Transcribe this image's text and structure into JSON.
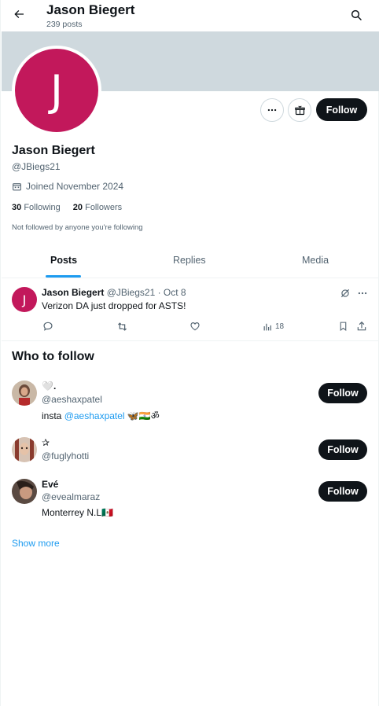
{
  "header": {
    "title": "Jason Biegert",
    "post_count": "239 posts"
  },
  "profile": {
    "avatar_letter": "J",
    "name": "Jason Biegert",
    "handle": "@JBiegs21",
    "joined": "Joined November 2024",
    "following_count": "30",
    "following_label": "Following",
    "followers_count": "20",
    "followers_label": "Followers",
    "not_followed_note": "Not followed by anyone you're following",
    "follow_label": "Follow",
    "accent_color": "#c2185b"
  },
  "tabs": [
    {
      "label": "Posts",
      "active": true
    },
    {
      "label": "Replies",
      "active": false
    },
    {
      "label": "Media",
      "active": false
    }
  ],
  "post": {
    "avatar_letter": "J",
    "author": "Jason Biegert",
    "meta": "@JBiegs21 · Oct 8",
    "text": "Verizon DA just dropped for ASTS!",
    "views": "18"
  },
  "who_to_follow": {
    "title": "Who to follow",
    "users": [
      {
        "name": "🤍.",
        "handle": "@aeshaxpatel",
        "bio_prefix": "insta ",
        "bio_link": "@aeshaxpatel",
        "bio_suffix": " 🦋🇮🇳ॐ",
        "follow_label": "Follow"
      },
      {
        "name": "✰",
        "handle": "@fuglyhotti",
        "follow_label": "Follow"
      },
      {
        "name": "Evé",
        "handle": "@evealmaraz",
        "bio_text": "Monterrey N.L🇲🇽",
        "follow_label": "Follow"
      }
    ],
    "show_more": "Show more"
  }
}
